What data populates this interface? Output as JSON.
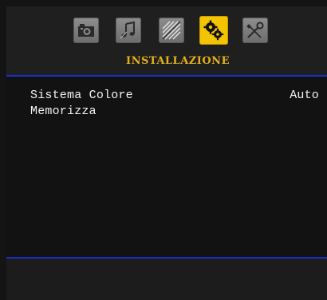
{
  "header": {
    "tabs": [
      {
        "icon": "camera-icon",
        "active": false
      },
      {
        "icon": "music-note-icon",
        "active": false
      },
      {
        "icon": "feature-lines-icon",
        "active": false
      },
      {
        "icon": "gears-icon",
        "active": true
      },
      {
        "icon": "tools-icon",
        "active": false
      }
    ],
    "active_tab_title": "INSTALLAZIONE",
    "active_color": "#f3c400",
    "title_color": "#e6b21a"
  },
  "menu": {
    "items": [
      {
        "label": "Sistema Colore",
        "value": "Auto"
      },
      {
        "label": "Memorizza",
        "value": ""
      }
    ]
  },
  "accent_color": "#1c2fc8"
}
